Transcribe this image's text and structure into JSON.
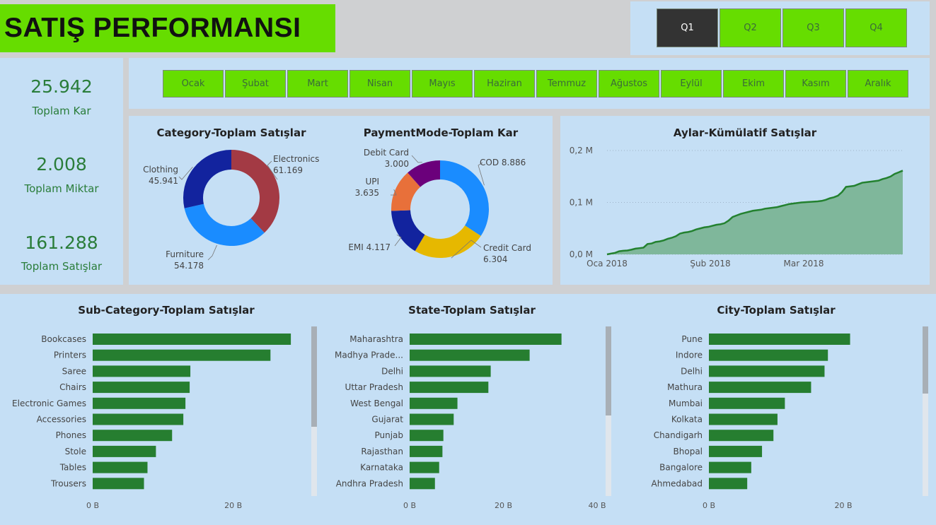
{
  "header": {
    "title": "SATIŞ PERFORMANSI"
  },
  "quarters": [
    {
      "label": "Q1",
      "active": true
    },
    {
      "label": "Q2",
      "active": false
    },
    {
      "label": "Q3",
      "active": false
    },
    {
      "label": "Q4",
      "active": false
    }
  ],
  "months": [
    "Ocak",
    "Şubat",
    "Mart",
    "Nisan",
    "Mayıs",
    "Haziran",
    "Temmuz",
    "Ağustos",
    "Eylül",
    "Ekim",
    "Kasım",
    "Aralık"
  ],
  "kpis": [
    {
      "value": "25.942",
      "label": "Toplam Kar"
    },
    {
      "value": "2.008",
      "label": "Toplam Miktar"
    },
    {
      "value": "161.288",
      "label": "Toplam Satışlar"
    }
  ],
  "colors": {
    "accent_green": "#66dd00",
    "bar_green": "#267e30",
    "area_fill": "#7fb79b",
    "line_green": "#23812f",
    "panel_bg": "#c5dff5"
  },
  "chart_data": [
    {
      "id": "category",
      "type": "pie",
      "title": "Category-Toplam Satışlar",
      "slices": [
        {
          "label": "Electronics",
          "value": 61169,
          "display": "61.169",
          "color": "#a33a44"
        },
        {
          "label": "Furniture",
          "value": 54178,
          "display": "54.178",
          "color": "#1a8cff"
        },
        {
          "label": "Clothing",
          "value": 45941,
          "display": "45.941",
          "color": "#12239e"
        }
      ]
    },
    {
      "id": "payment",
      "type": "pie",
      "title": "PaymentMode-Toplam Kar",
      "slices": [
        {
          "label": "COD",
          "value": 8886,
          "display": "8.886",
          "color": "#1a8cff"
        },
        {
          "label": "Credit Card",
          "value": 6304,
          "display": "6.304",
          "color": "#e6b800"
        },
        {
          "label": "EMI",
          "value": 4117,
          "display": "4.117",
          "color": "#12239e"
        },
        {
          "label": "UPI",
          "value": 3635,
          "display": "3.635",
          "color": "#e8703a"
        },
        {
          "label": "Debit Card",
          "value": 3000,
          "display": "3.000",
          "color": "#6b007b"
        }
      ]
    },
    {
      "id": "cumulative",
      "type": "area",
      "title": "Aylar-Kümülatif Satışlar",
      "x_ticks": [
        "Oca 2018",
        "Şub 2018",
        "Mar 2018"
      ],
      "y_ticks": [
        "0,0 M",
        "0,1 M",
        "0,2 M"
      ],
      "ylim": [
        0,
        200000
      ],
      "values": [
        0,
        1500,
        3000,
        6000,
        7000,
        7500,
        9000,
        11000,
        12000,
        13000,
        20000,
        21000,
        24000,
        25000,
        27000,
        30000,
        32000,
        35000,
        40000,
        42000,
        43000,
        45000,
        48000,
        50000,
        52000,
        53000,
        55000,
        57000,
        58000,
        60000,
        65000,
        72000,
        75000,
        78000,
        80000,
        82000,
        84000,
        85000,
        86000,
        88000,
        89000,
        90000,
        91000,
        93000,
        95000,
        97000,
        98000,
        99000,
        100000,
        100500,
        101000,
        101500,
        102000,
        103000,
        105000,
        108000,
        110000,
        113000,
        120000,
        130000,
        131000,
        132000,
        135000,
        138000,
        139000,
        140000,
        141000,
        142000,
        145000,
        147000,
        150000,
        155000,
        158000,
        161288
      ]
    },
    {
      "id": "subcategory",
      "type": "bar",
      "title": "Sub-Category-Toplam Satışlar",
      "categories": [
        "Bookcases",
        "Printers",
        "Saree",
        "Chairs",
        "Electronic Games",
        "Accessories",
        "Phones",
        "Stole",
        "Tables",
        "Trousers"
      ],
      "values": [
        28.2,
        25.3,
        13.9,
        13.8,
        13.2,
        12.9,
        11.3,
        9.0,
        7.8,
        7.3
      ],
      "x_ticks": [
        {
          "value": 0,
          "label": "0 B"
        },
        {
          "value": 20,
          "label": "20 B"
        }
      ],
      "xlim": [
        0,
        29.8
      ]
    },
    {
      "id": "state",
      "type": "bar",
      "title": "State-Toplam Satışlar",
      "categories": [
        "Maharashtra",
        "Madhya Prade...",
        "Delhi",
        "Uttar Pradesh",
        "West Bengal",
        "Gujarat",
        "Punjab",
        "Rajasthan",
        "Karnataka",
        "Andhra Pradesh"
      ],
      "values": [
        32.4,
        25.6,
        17.3,
        16.8,
        10.2,
        9.4,
        7.2,
        7.0,
        6.3,
        5.4
      ],
      "x_ticks": [
        {
          "value": 0,
          "label": "0 B"
        },
        {
          "value": 20,
          "label": "20 B"
        },
        {
          "value": 40,
          "label": "40 B"
        }
      ],
      "xlim": [
        0,
        40
      ]
    },
    {
      "id": "city",
      "type": "bar",
      "title": "City-Toplam Satışlar",
      "categories": [
        "Pune",
        "Indore",
        "Delhi",
        "Mathura",
        "Mumbai",
        "Kolkata",
        "Chandigarh",
        "Bhopal",
        "Bangalore",
        "Ahmedabad"
      ],
      "values": [
        21.0,
        17.7,
        17.2,
        15.2,
        11.3,
        10.2,
        9.6,
        7.9,
        6.3,
        5.7
      ],
      "x_ticks": [
        {
          "value": 0,
          "label": "0 B"
        },
        {
          "value": 20,
          "label": "20 B"
        }
      ],
      "xlim": [
        0,
        30.2
      ]
    }
  ]
}
